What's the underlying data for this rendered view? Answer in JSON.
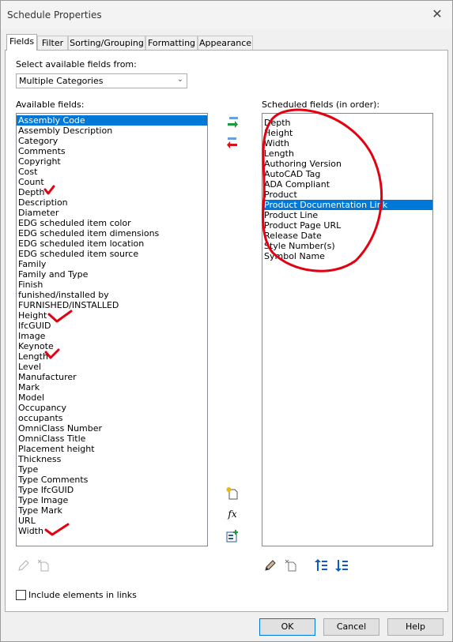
{
  "window": {
    "title": "Schedule Properties",
    "close_glyph": "✕"
  },
  "tabs": [
    "Fields",
    "Filter",
    "Sorting/Grouping",
    "Formatting",
    "Appearance"
  ],
  "active_tab": "Fields",
  "select_from": {
    "label": "Select available fields from:",
    "value": "Multiple Categories"
  },
  "available": {
    "label": "Available fields:",
    "selected": "Assembly Code",
    "items": [
      "Assembly Code",
      "Assembly Description",
      "Category",
      "Comments",
      "Copyright",
      "Cost",
      "Count",
      "Depth",
      "Description",
      "Diameter",
      "EDG scheduled item color",
      "EDG scheduled item dimensions",
      "EDG scheduled item location",
      "EDG scheduled item source",
      "Family",
      "Family and Type",
      "Finish",
      "funished/installed by",
      "FURNISHED/INSTALLED",
      "Height",
      "IfcGUID",
      "Image",
      "Keynote",
      "Length",
      "Level",
      "Manufacturer",
      "Mark",
      "Model",
      "Occupancy",
      "occupants",
      "OmniClass Number",
      "OmniClass Title",
      "Placement height",
      "Thickness",
      "Type",
      "Type Comments",
      "Type IfcGUID",
      "Type Image",
      "Type Mark",
      "URL",
      "Width"
    ]
  },
  "scheduled": {
    "label": "Scheduled fields (in order):",
    "selected": "Product Documentation Link",
    "items": [
      "Depth",
      "Height",
      "Width",
      "Length",
      "Authoring Version",
      "AutoCAD Tag",
      "ADA Compliant",
      "Product",
      "Product Documentation Link",
      "Product Line",
      "Product Page URL",
      "Release Date",
      "Style Number(s)",
      "Symbol Name"
    ]
  },
  "icons": {
    "add": "add-parameter-icon",
    "remove": "remove-parameter-icon",
    "new_param": "new-parameter-icon",
    "calc": "calculated-value-icon",
    "combine": "combine-parameters-icon",
    "edit": "edit-parameter-icon",
    "delete": "delete-parameter-icon",
    "move_up": "move-up-icon",
    "move_down": "move-down-icon"
  },
  "calc_glyph": "fx",
  "include_links": {
    "label": "Include elements in links",
    "checked": false
  },
  "buttons": {
    "ok": "OK",
    "cancel": "Cancel",
    "help": "Help"
  },
  "colors": {
    "accent": "#0078d7",
    "annotation": "#e3000f",
    "arrow_green": "#1a9b3c",
    "arrow_red": "#d4141c"
  }
}
